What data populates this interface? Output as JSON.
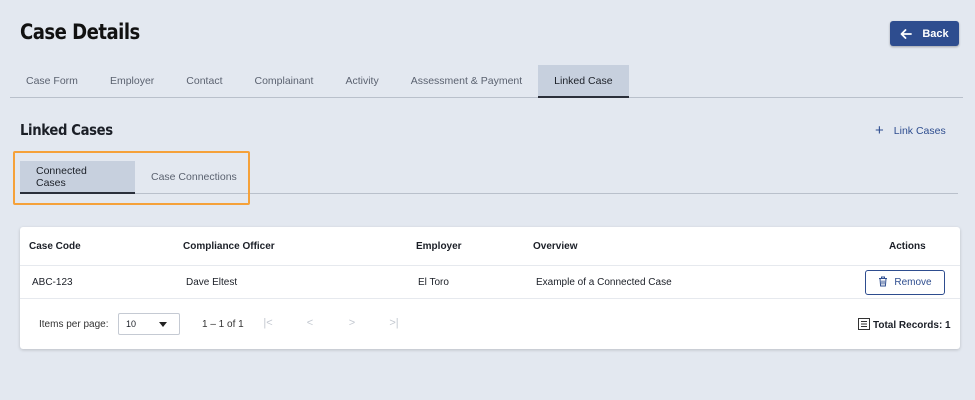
{
  "header": {
    "title": "Case Details",
    "back_label": "Back"
  },
  "tabs": [
    {
      "label": "Case Form",
      "active": false
    },
    {
      "label": "Employer",
      "active": false
    },
    {
      "label": "Contact",
      "active": false
    },
    {
      "label": "Complainant",
      "active": false
    },
    {
      "label": "Activity",
      "active": false
    },
    {
      "label": "Assessment & Payment",
      "active": false
    },
    {
      "label": "Linked Case",
      "active": true
    }
  ],
  "section": {
    "title": "Linked Cases",
    "link_label": "Link Cases"
  },
  "subtabs": [
    {
      "label": "Connected Cases",
      "active": true
    },
    {
      "label": "Case Connections",
      "active": false
    }
  ],
  "table": {
    "columns": [
      "Case Code",
      "Compliance Officer",
      "Employer",
      "Overview",
      "Actions"
    ],
    "rows": [
      {
        "case_code": "ABC-123",
        "officer": "Dave Eltest",
        "employer": "El Toro",
        "overview": "Example of a Connected Case",
        "action": "Remove"
      }
    ]
  },
  "pager": {
    "items_per_page_label": "Items per page:",
    "items_per_page": "10",
    "range": "1 – 1 of 1",
    "total_label": "Total Records: 1"
  },
  "colors": {
    "accent": "#2e4d8f",
    "highlight": "#f5a13a",
    "background": "#e3e8f0"
  }
}
